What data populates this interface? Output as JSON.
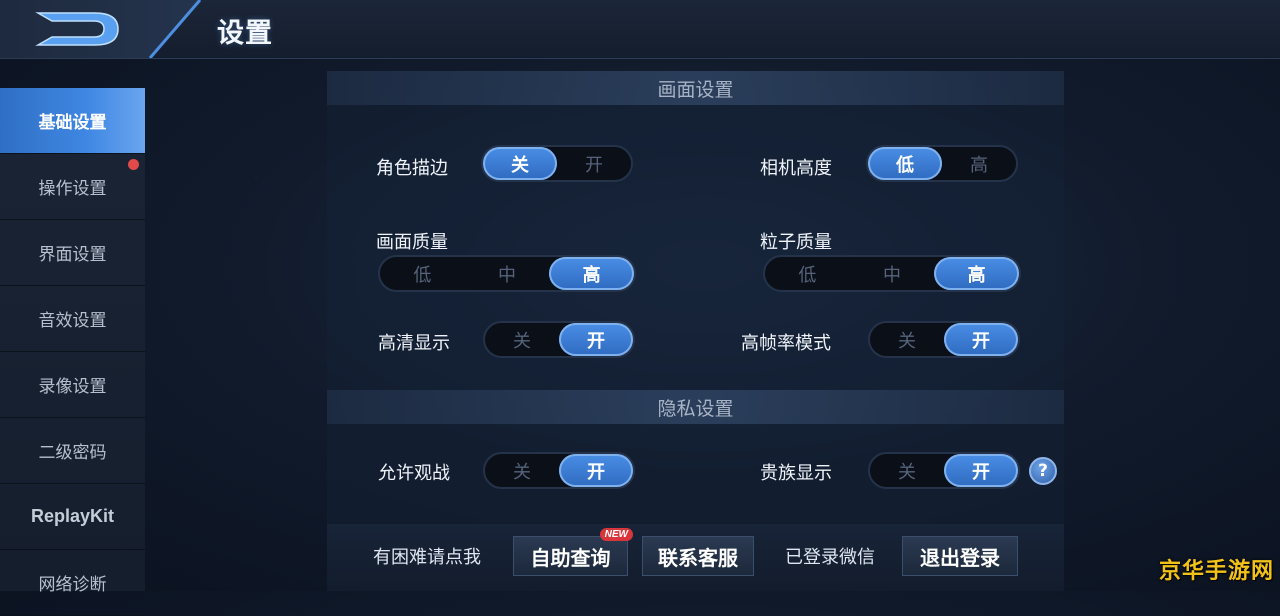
{
  "header": {
    "title": "设置"
  },
  "sidebar": {
    "items": [
      {
        "label": "基础设置"
      },
      {
        "label": "操作设置"
      },
      {
        "label": "界面设置"
      },
      {
        "label": "音效设置"
      },
      {
        "label": "录像设置"
      },
      {
        "label": "二级密码"
      },
      {
        "label": "ReplayKit"
      },
      {
        "label": "网络诊断"
      }
    ]
  },
  "sections": {
    "display": {
      "title": "画面设置"
    },
    "privacy": {
      "title": "隐私设置"
    }
  },
  "settings": {
    "outline": {
      "label": "角色描边",
      "options": [
        "关",
        "开"
      ],
      "selected": "关"
    },
    "camera_height": {
      "label": "相机高度",
      "options": [
        "低",
        "高"
      ],
      "selected": "低"
    },
    "image_quality": {
      "label": "画面质量",
      "options": [
        "低",
        "中",
        "高"
      ],
      "selected": "高"
    },
    "particle_quality": {
      "label": "粒子质量",
      "options": [
        "低",
        "中",
        "高"
      ],
      "selected": "高"
    },
    "hd_display": {
      "label": "高清显示",
      "options": [
        "关",
        "开"
      ],
      "selected": "开"
    },
    "high_fps": {
      "label": "高帧率模式",
      "options": [
        "关",
        "开"
      ],
      "selected": "开"
    },
    "allow_spectate": {
      "label": "允许观战",
      "options": [
        "关",
        "开"
      ],
      "selected": "开"
    },
    "noble_display": {
      "label": "贵族显示",
      "options": [
        "关",
        "开"
      ],
      "selected": "开"
    }
  },
  "bottom": {
    "help_text": "有困难请点我",
    "self_service": "自助查询",
    "new_badge": "NEW",
    "contact_service": "联系客服",
    "login_status": "已登录微信",
    "logout": "退出登录"
  },
  "watermark": "京华手游网"
}
